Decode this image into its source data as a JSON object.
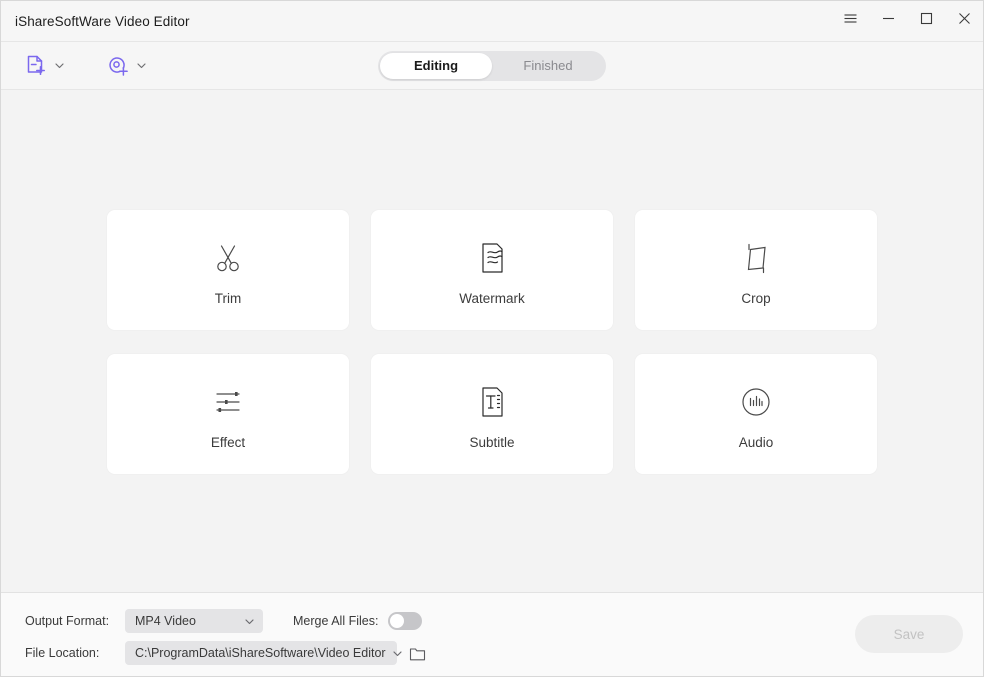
{
  "window": {
    "title": "iShareSoftWare Video Editor",
    "controls": [
      {
        "name": "menu-button",
        "glyph": "menu"
      },
      {
        "name": "minimize-button",
        "glyph": "minimize"
      },
      {
        "name": "maximize-button",
        "glyph": "maximize"
      },
      {
        "name": "close-button",
        "glyph": "close"
      }
    ]
  },
  "toolbar": {
    "add_file": {
      "icon": "add-file-icon",
      "caret": "chevron-down-icon"
    },
    "add_disc": {
      "icon": "add-disc-icon",
      "caret": "chevron-down-icon"
    },
    "tabs": [
      {
        "label": "Editing",
        "active": true
      },
      {
        "label": "Finished",
        "active": false
      }
    ]
  },
  "main": {
    "cards": [
      {
        "label": "Trim",
        "icon": "scissors-icon"
      },
      {
        "label": "Watermark",
        "icon": "watermark-document-icon"
      },
      {
        "label": "Crop",
        "icon": "crop-parallelogram-icon"
      },
      {
        "label": "Effect",
        "icon": "sliders-icon"
      },
      {
        "label": "Subtitle",
        "icon": "subtitle-document-icon"
      },
      {
        "label": "Audio",
        "icon": "audio-waveform-circle-icon"
      }
    ]
  },
  "bottom": {
    "output_format_label": "Output Format:",
    "output_format_value": "MP4 Video",
    "merge_label": "Merge All Files:",
    "merge_enabled": false,
    "file_location_label": "File Location:",
    "file_location_value": "C:\\ProgramData\\iShareSoftware\\Video Editor",
    "browse_icon": "folder-icon",
    "save_label": "Save",
    "save_enabled": false
  },
  "colors": {
    "accent": "#7b68ee",
    "window_bg": "#f6f6f6",
    "content_bg": "#f3f3f3",
    "card_bg": "#ffffff",
    "control_bg": "#e4e4e6"
  }
}
